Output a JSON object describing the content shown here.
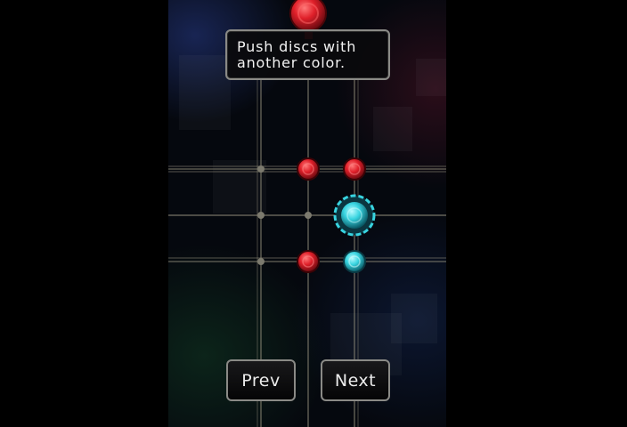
{
  "tutorial": {
    "line1": "Push discs with",
    "line2": "another color."
  },
  "navigation": {
    "prev_label": "Prev",
    "next_label": "Next"
  },
  "board": {
    "grid": "3x3",
    "pieces": [
      {
        "row": 1,
        "col": 1,
        "color": "red",
        "kind": "small"
      },
      {
        "row": 1,
        "col": 2,
        "color": "red",
        "kind": "small"
      },
      {
        "row": 2,
        "col": 2,
        "color": "cyan",
        "kind": "large"
      },
      {
        "row": 3,
        "col": 1,
        "color": "red",
        "kind": "small"
      },
      {
        "row": 3,
        "col": 2,
        "color": "cyan",
        "kind": "small"
      }
    ],
    "pointer": {
      "color": "red",
      "kind": "drop-pointer"
    }
  },
  "colors": {
    "red": "#e0202a",
    "cyan": "#38d4e0",
    "line": "#9a9682",
    "panel_border": "#8a8a86"
  }
}
